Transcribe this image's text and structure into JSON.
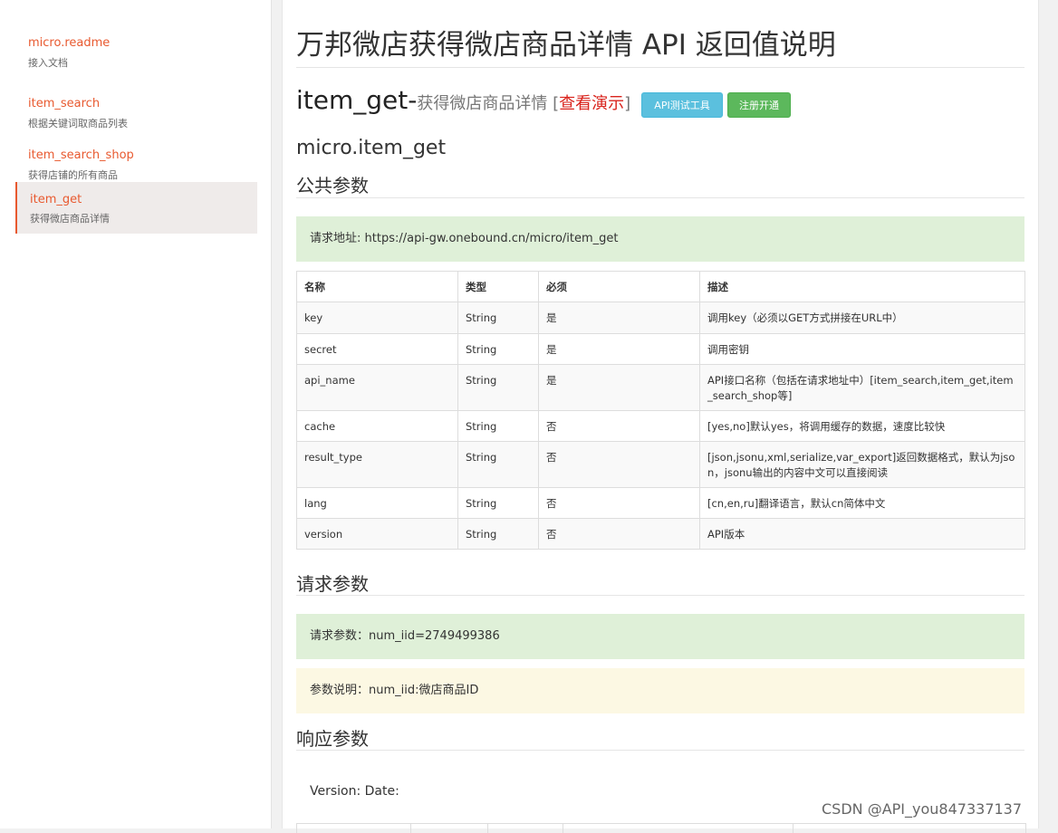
{
  "sidebar": {
    "items": [
      {
        "title": "micro.readme",
        "subtitle": "接入文档"
      },
      {
        "title": "item_search",
        "subtitle": "根据关键词取商品列表"
      },
      {
        "title": "item_search_shop",
        "subtitle": "获得店铺的所有商品"
      },
      {
        "title": "item_get",
        "subtitle": "获得微店商品详情",
        "active": true
      }
    ]
  },
  "main": {
    "page_title": "万邦微店获得微店商品详情 API 返回值说明",
    "api_name": "item_get-",
    "api_desc": "获得微店商品详情",
    "bracket_open": " [",
    "demo_link": "查看演示",
    "bracket_close": "]",
    "btn_test": "API测试工具",
    "btn_register": "注册开通",
    "method_name": "micro.item_get",
    "public_params_heading": "公共参数",
    "request_url": "请求地址: https://api-gw.onebound.cn/micro/item_get",
    "table": {
      "headers": [
        "名称",
        "类型",
        "必须",
        "描述"
      ],
      "rows": [
        [
          "key",
          "String",
          "是",
          "调用key（必须以GET方式拼接在URL中）"
        ],
        [
          "secret",
          "String",
          "是",
          "调用密钥"
        ],
        [
          "api_name",
          "String",
          "是",
          "API接口名称（包括在请求地址中）[item_search,item_get,item_search_shop等]"
        ],
        [
          "cache",
          "String",
          "否",
          "[yes,no]默认yes，将调用缓存的数据，速度比较快"
        ],
        [
          "result_type",
          "String",
          "否",
          "[json,jsonu,xml,serialize,var_export]返回数据格式，默认为json，jsonu输出的内容中文可以直接阅读"
        ],
        [
          "lang",
          "String",
          "否",
          "[cn,en,ru]翻译语言，默认cn简体中文"
        ],
        [
          "version",
          "String",
          "否",
          "API版本"
        ]
      ]
    },
    "request_params_heading": "请求参数",
    "request_params": "请求参数：num_iid=2749499386",
    "param_desc": "参数说明：num_iid:微店商品ID",
    "response_params_heading": "响应参数",
    "version_line": "Version: Date:"
  },
  "watermark": "CSDN @API_you847337137"
}
